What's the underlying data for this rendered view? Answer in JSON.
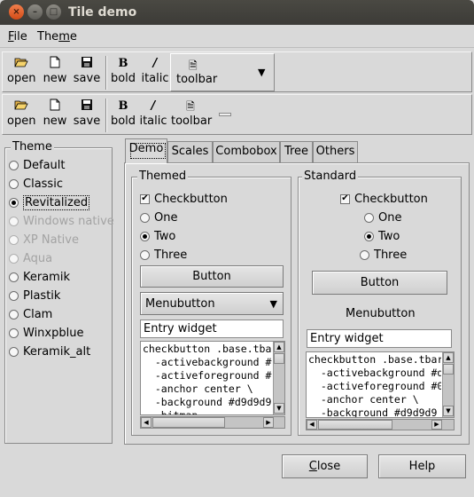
{
  "window": {
    "title": "Tile demo",
    "close_glyph": "×",
    "min_glyph": "–",
    "max_glyph": "□"
  },
  "menubar": {
    "file": {
      "prefix": "",
      "ul": "F",
      "rest": "ile"
    },
    "theme": {
      "prefix": "The",
      "ul": "m",
      "rest": "e"
    }
  },
  "toolbar1": {
    "open": "open",
    "new": "new",
    "save": "save",
    "bold": "bold",
    "italic": "italic",
    "toolbar": "toolbar",
    "menu_arrow": "▼"
  },
  "toolbar2": {
    "open": "open",
    "new": "new",
    "save": "save",
    "bold": "bold",
    "italic": "italic",
    "toolbar": "toolbar"
  },
  "icons": {
    "open": "folder-open-icon",
    "new": "new-file-icon",
    "save": "floppy-save-icon",
    "bold": "bold-B-icon",
    "italic": "italic-slash-icon",
    "toolbar": "document-icon"
  },
  "theme_group": {
    "legend": "Theme",
    "items": [
      {
        "label": "Default",
        "selected": false,
        "enabled": true
      },
      {
        "label": "Classic",
        "selected": false,
        "enabled": true
      },
      {
        "label": "Revitalized",
        "selected": true,
        "enabled": true
      },
      {
        "label": "Windows native",
        "selected": false,
        "enabled": false
      },
      {
        "label": "XP Native",
        "selected": false,
        "enabled": false
      },
      {
        "label": "Aqua",
        "selected": false,
        "enabled": false
      },
      {
        "label": "Keramik",
        "selected": false,
        "enabled": true
      },
      {
        "label": "Plastik",
        "selected": false,
        "enabled": true
      },
      {
        "label": "Clam",
        "selected": false,
        "enabled": true
      },
      {
        "label": "Winxpblue",
        "selected": false,
        "enabled": true
      },
      {
        "label": "Keramik_alt",
        "selected": false,
        "enabled": true
      }
    ]
  },
  "tabs": [
    {
      "label": "Demo",
      "active": true
    },
    {
      "label": "Scales",
      "active": false
    },
    {
      "label": "Combobox",
      "active": false
    },
    {
      "label": "Tree",
      "active": false
    },
    {
      "label": "Others",
      "active": false
    }
  ],
  "themed": {
    "legend": "Themed",
    "checkbutton": "Checkbutton",
    "one": "One",
    "two": "Two",
    "three": "Three",
    "selected": "Two",
    "button": "Button",
    "menubutton": "Menubutton",
    "entry": "Entry widget",
    "text_lines": [
      "checkbutton .base.tba",
      "  -activebackground #",
      "  -activeforeground #",
      "  -anchor center \\",
      "  -background #d9d9d9",
      "  -bitmap ..."
    ]
  },
  "standard": {
    "legend": "Standard",
    "checkbutton": "Checkbutton",
    "one": "One",
    "two": "Two",
    "three": "Three",
    "selected": "Two",
    "button": "Button",
    "menubutton": "Menubutton",
    "entry": "Entry widget",
    "text_lines": [
      "checkbutton .base.tbar",
      "  -activebackground #d",
      "  -activeforeground #0",
      "  -anchor center \\",
      "  -background #d9d9d9"
    ]
  },
  "dialog": {
    "close": "Close",
    "help": "Help"
  }
}
